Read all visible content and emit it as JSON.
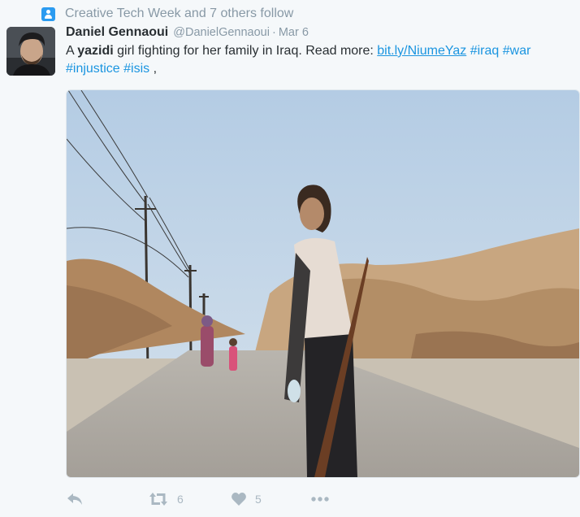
{
  "context": {
    "icon": "person-icon",
    "text": "Creative Tech Week and 7 others follow"
  },
  "tweet": {
    "fullname": "Daniel Gennaoui",
    "username": "@DanielGennaoui",
    "separator": "·",
    "timestamp": "Mar 6",
    "text_before": "A ",
    "text_bold": "yazidi",
    "text_middle": " girl fighting for her family in Iraq. Read more: ",
    "link": "bit.ly/NiumeYaz",
    "hashtags": [
      "#iraq",
      "#war",
      "#injustice",
      "#isis"
    ],
    "text_end": ","
  },
  "actions": {
    "reply_icon": "reply-icon",
    "retweet_icon": "retweet-icon",
    "retweet_count": "6",
    "like_icon": "heart-icon",
    "like_count": "5",
    "more_icon": "more-icon"
  },
  "colors": {
    "link": "#1b95e0",
    "muted": "#8899a6",
    "icon": "#aab8c2",
    "background": "#f5f8fa"
  }
}
